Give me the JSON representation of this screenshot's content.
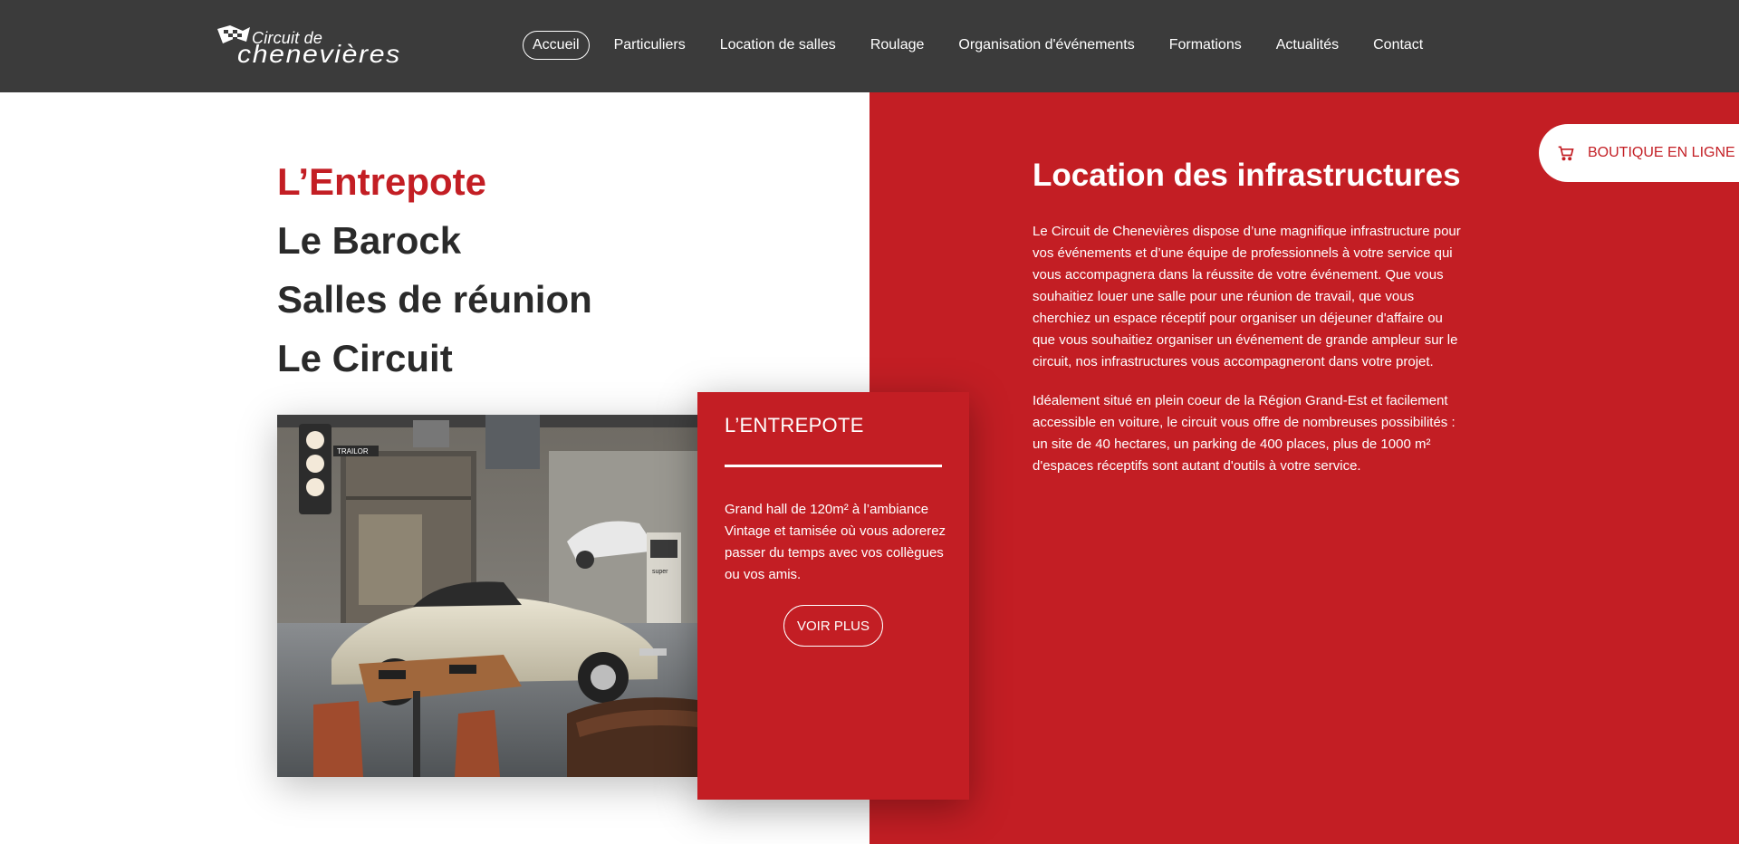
{
  "header": {
    "logo": {
      "line1": "Circuit de",
      "line2": "chenevières"
    },
    "nav": [
      {
        "label": "Accueil",
        "active": true
      },
      {
        "label": "Particuliers"
      },
      {
        "label": "Location de salles"
      },
      {
        "label": "Roulage"
      },
      {
        "label": "Organisation d'événements"
      },
      {
        "label": "Formations"
      },
      {
        "label": "Actualités"
      },
      {
        "label": "Contact"
      }
    ]
  },
  "shop_button": {
    "label": "BOUTIQUE EN LIGNE",
    "icon": "cart-icon"
  },
  "venues": [
    {
      "label": "L’Entrepote",
      "active": true
    },
    {
      "label": "Le Barock"
    },
    {
      "label": "Salles de réunion"
    },
    {
      "label": "Le Circuit"
    }
  ],
  "card": {
    "title": "L’ENTREPOTE",
    "text": "Grand hall de 120m² à l’ambiance Vintage et tamisée où vous adorerez passer du temps avec vos collègues ou vos amis.",
    "button": "VOIR PLUS"
  },
  "photo": {
    "sign_text": "TRAILOR",
    "pump_text": "super"
  },
  "infra": {
    "title": "Location des infrastructures",
    "paragraphs": [
      "Le Circuit de Chenevières dispose d’une magnifique infrastructure pour vos événements et d’une équipe de professionnels à votre service qui vous accompagnera dans la réussite de votre événement. Que vous souhaitiez louer une salle pour une réunion de travail, que vous cherchiez un espace réceptif pour organiser un déjeuner d'affaire ou que vous souhaitiez organiser un événement de grande ampleur sur le circuit, nos infrastructures vous accompagneront dans votre projet.",
      "Idéalement situé en plein coeur de la Région Grand-Est et facilement accessible en voiture, le circuit vous offre de nombreuses possibilités : un site de 40 hectares, un parking de 400 places, plus de 1000 m² d'espaces réceptifs sont autant d'outils à votre service."
    ]
  },
  "colors": {
    "header_bg": "#3b3b3b",
    "accent_red": "#c31e24",
    "dark_text": "#2a2a2a"
  }
}
